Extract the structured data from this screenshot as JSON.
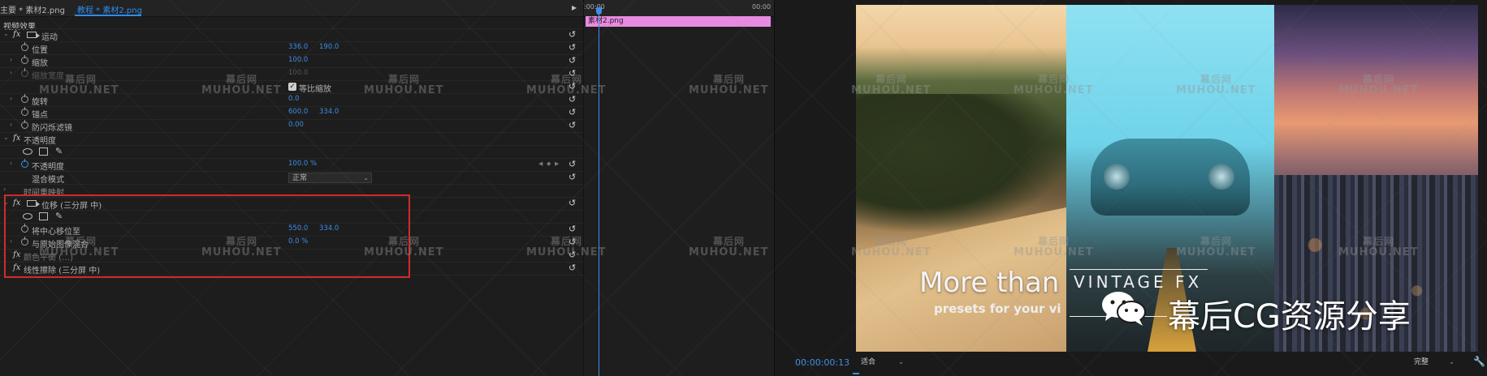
{
  "tabs": {
    "master": "主要 * 素材2.png",
    "sequence": "教程 * 素材2.png"
  },
  "panel_title": "视频效果",
  "rows": {
    "motion": "运动",
    "position": {
      "label": "位置",
      "x": "336.0",
      "y": "190.0"
    },
    "scale": {
      "label": "缩放",
      "value": "100.0"
    },
    "scale_width": {
      "label": "缩放宽度",
      "value": "100.0"
    },
    "uniform_scale": "等比缩放",
    "rotation": {
      "label": "旋转",
      "value": "0.0"
    },
    "anchor": {
      "label": "锚点",
      "x": "600.0",
      "y": "334.0"
    },
    "antiflicker": {
      "label": "防闪烁滤镜",
      "value": "0.00"
    },
    "opacity_section": "不透明度",
    "opacity": {
      "label": "不透明度",
      "value": "100.0 %"
    },
    "blend_mode": {
      "label": "混合模式",
      "value": "正常"
    },
    "time_remap": "时间重映射",
    "offset_effect": "位移 (三分屏 中)",
    "shift_center": {
      "label": "将中心移位至",
      "x": "550.0",
      "y": "334.0"
    },
    "blend_original": {
      "label": "与原始图像混合",
      "value": "0.0 %"
    },
    "other_effect": "颜色平衡 (…)",
    "linear_wipe": "线性擦除 (三分屏 中)"
  },
  "timeline": {
    "start": ":00:00",
    "end": "00:00",
    "clip_label": "素材2.png"
  },
  "program": {
    "video_title": "More than",
    "video_subtitle": "presets for your vi",
    "video_logo": "VINTAGE FX",
    "timecode": "00:00:00:13",
    "fit": "适合",
    "quality": "完整"
  },
  "watermark": {
    "cn": "幕后网",
    "en": "MUHOU.NET",
    "brand": "幕后CG资源分享"
  },
  "colors": {
    "accent_blue": "#3e90e8",
    "clip_pink": "#e78be0",
    "highlight_red": "#d42a2a"
  }
}
